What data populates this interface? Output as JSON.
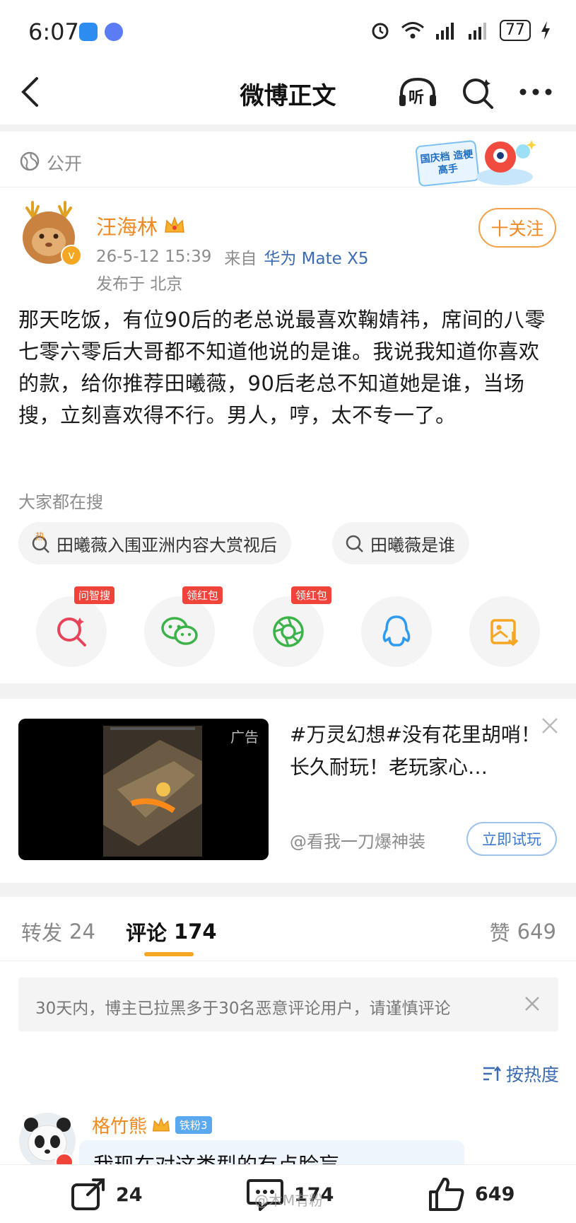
{
  "status": {
    "time": "6:07",
    "battery": "77"
  },
  "nav": {
    "title": "微博正文",
    "listen_label": "听"
  },
  "visibility": {
    "label": "公开",
    "banner_text": "国庆档 造梗高手"
  },
  "author": {
    "name": "汪海林",
    "timestamp": "26-5-12 15:39",
    "source_prefix": "来自",
    "device": "华为 Mate X5",
    "location": "发布于 北京",
    "follow_label": "十关注"
  },
  "post": {
    "text": "那天吃饭，有位90后的老总说最喜欢鞠婧祎，席间的八零七零六零后大哥都不知道他说的是谁。我说我知道你喜欢的款，给你推荐田曦薇，90后老总不知道她是谁，当场搜，立刻喜欢得不行。男人，哼，太不专一了。"
  },
  "searching": {
    "label": "大家都在搜",
    "hot_badge": "热",
    "chips": [
      "田曦薇入围亚洲内容大赏视后",
      "田曦薇是谁"
    ]
  },
  "share": {
    "badges": [
      "问智搜",
      "领红包",
      "领红包"
    ],
    "targets": [
      "wenzhisou-icon",
      "wechat-icon",
      "moments-icon",
      "qq-icon",
      "save-image-icon"
    ]
  },
  "ad": {
    "tag": "广告",
    "title": "#万灵幻想#没有花里胡哨！长久耐玩！老玩家心…",
    "account": "@看我一刀爆神装",
    "cta": "立即试玩"
  },
  "tabs": {
    "repost_label": "转发",
    "repost_count": "24",
    "comment_label": "评论",
    "comment_count": "174",
    "like_label": "赞",
    "like_count": "649"
  },
  "notice": {
    "text": "30天内，博主已拉黑多于30名恶意评论用户，请谨慎评论"
  },
  "sort": {
    "label": "按热度"
  },
  "comment": {
    "author": "格竹熊",
    "fan_badge": "铁粉3",
    "text": "我现在对这类型的有点脸盲"
  },
  "bottom": {
    "repost": "24",
    "comment": "174",
    "like": "649",
    "watermark": "@木M有粉"
  },
  "colors": {
    "accent_orange": "#f08a24",
    "link_blue": "#3b6bb0",
    "divider": "#f2f2f2"
  }
}
